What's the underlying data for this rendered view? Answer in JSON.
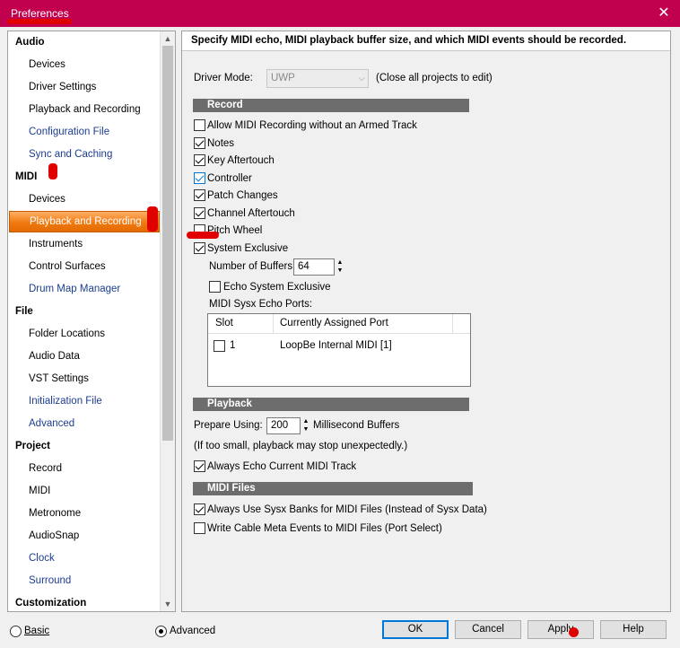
{
  "window": {
    "title": "Preferences",
    "close_glyph": "✕"
  },
  "sidebar": {
    "items": [
      {
        "label": "Audio",
        "kind": "category"
      },
      {
        "label": "Devices",
        "kind": "item"
      },
      {
        "label": "Driver Settings",
        "kind": "item"
      },
      {
        "label": "Playback and Recording",
        "kind": "item"
      },
      {
        "label": "Configuration File",
        "kind": "link"
      },
      {
        "label": "Sync and Caching",
        "kind": "link"
      },
      {
        "label": "MIDI",
        "kind": "category"
      },
      {
        "label": "Devices",
        "kind": "item"
      },
      {
        "label": "Playback and Recording",
        "kind": "selected"
      },
      {
        "label": "Instruments",
        "kind": "item"
      },
      {
        "label": "Control Surfaces",
        "kind": "item"
      },
      {
        "label": "Drum Map Manager",
        "kind": "link"
      },
      {
        "label": "File",
        "kind": "category"
      },
      {
        "label": "Folder Locations",
        "kind": "item"
      },
      {
        "label": "Audio Data",
        "kind": "item"
      },
      {
        "label": "VST Settings",
        "kind": "item"
      },
      {
        "label": "Initialization File",
        "kind": "link"
      },
      {
        "label": "Advanced",
        "kind": "link"
      },
      {
        "label": "Project",
        "kind": "category"
      },
      {
        "label": "Record",
        "kind": "item"
      },
      {
        "label": "MIDI",
        "kind": "item"
      },
      {
        "label": "Metronome",
        "kind": "item"
      },
      {
        "label": "AudioSnap",
        "kind": "item"
      },
      {
        "label": "Clock",
        "kind": "link"
      },
      {
        "label": "Surround",
        "kind": "link"
      },
      {
        "label": "Customization",
        "kind": "category"
      }
    ],
    "scroll_up_glyph": "▲",
    "scroll_down_glyph": "▼"
  },
  "header": {
    "text": "Specify MIDI echo, MIDI playback buffer size, and which MIDI events should be recorded."
  },
  "driver": {
    "label": "Driver Mode:",
    "value": "UWP",
    "note": "(Close all projects to edit)",
    "chevron": "⌵"
  },
  "record": {
    "title": "Record",
    "options": [
      {
        "label": "Allow MIDI Recording without an Armed Track",
        "checked": false
      },
      {
        "label": "Notes",
        "checked": true
      },
      {
        "label": "Key Aftertouch",
        "checked": true
      },
      {
        "label": "Controller",
        "checked": true,
        "focus": true
      },
      {
        "label": "Patch Changes",
        "checked": true
      },
      {
        "label": "Channel Aftertouch",
        "checked": true
      },
      {
        "label": "Pitch Wheel",
        "checked": false
      },
      {
        "label": "System Exclusive",
        "checked": true
      }
    ],
    "buffers_label": "Number of Buffers:",
    "buffers_value": "64",
    "echo_sysex": {
      "label": "Echo System Exclusive",
      "checked": false
    },
    "echo_ports_label": "MIDI Sysx Echo Ports:",
    "ports_columns": [
      "Slot",
      "Currently Assigned Port"
    ],
    "ports_rows": [
      {
        "slot": "1",
        "port": "LoopBe Internal MIDI [1]",
        "checked": false
      }
    ]
  },
  "playback": {
    "title": "Playback",
    "prepare_label": "Prepare Using:",
    "prepare_value": "200",
    "prepare_unit": "Millisecond Buffers",
    "hint": "(If too small, playback may stop unexpectedly.)",
    "always_echo": {
      "label": "Always Echo Current MIDI Track",
      "checked": true
    }
  },
  "midi_files": {
    "title": "MIDI Files",
    "options": [
      {
        "label": "Always Use Sysx Banks for MIDI Files (Instead of Sysx Data)",
        "checked": true
      },
      {
        "label": "Write Cable Meta Events to MIDI Files (Port Select)",
        "checked": false
      }
    ]
  },
  "footer": {
    "mode_basic": "Basic",
    "mode_advanced": "Advanced",
    "selected_mode": "Advanced",
    "ok": "OK",
    "cancel": "Cancel",
    "apply": "Apply",
    "help": "Help"
  },
  "colors": {
    "title_bar": "#c2014e",
    "selection": "#f07a10",
    "section_bar": "#6d6d6d",
    "link": "#1c3d8f",
    "annotation": "#e10000",
    "focus": "#0078d7"
  },
  "spin_glyphs": {
    "up": "▲",
    "down": "▼"
  }
}
